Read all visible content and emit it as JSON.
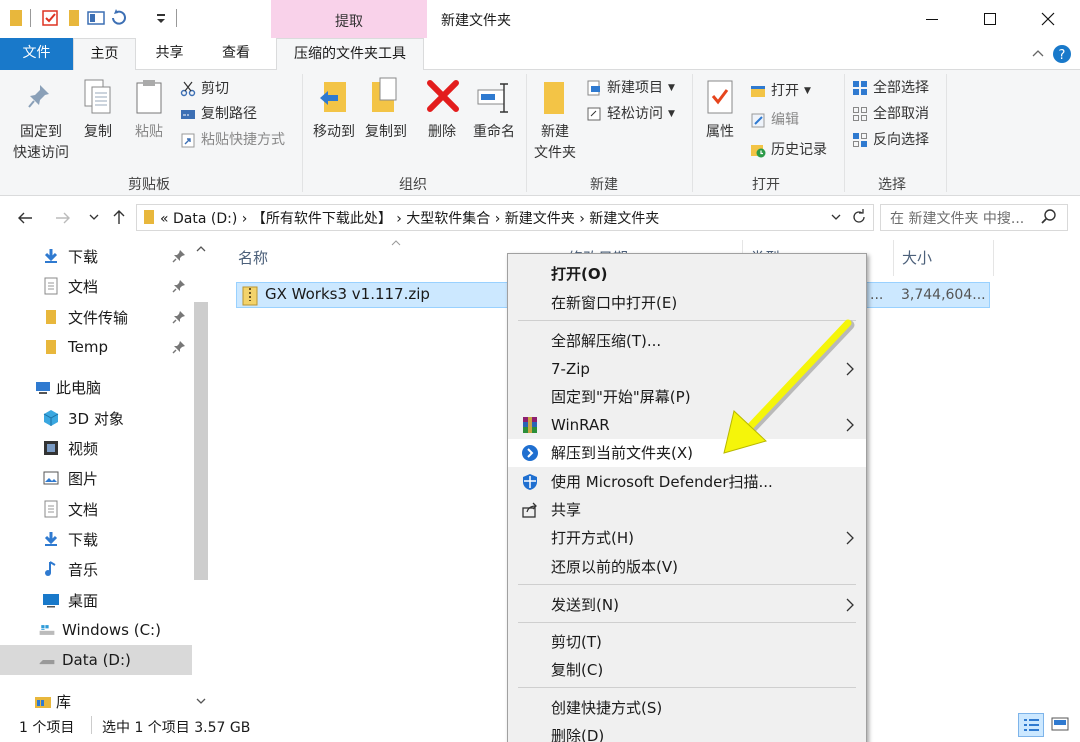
{
  "window": {
    "title": "新建文件夹",
    "tools_context_label": "提取"
  },
  "ribbon_tabs": {
    "file": "文件",
    "home": "主页",
    "share": "共享",
    "view": "查看",
    "zip_tools": "压缩的文件夹工具"
  },
  "ribbon": {
    "clipboard": {
      "pin_quick": "固定到\n快速访问",
      "copy": "复制",
      "paste": "粘贴",
      "cut": "剪切",
      "copy_path": "复制路径",
      "paste_shortcut": "粘贴快捷方式",
      "group": "剪贴板"
    },
    "organize": {
      "move_to": "移动到",
      "copy_to": "复制到",
      "delete": "删除",
      "rename": "重命名",
      "group": "组织"
    },
    "new": {
      "new_folder": "新建\n文件夹",
      "new_item": "新建项目",
      "easy_access": "轻松访问",
      "group": "新建"
    },
    "open": {
      "properties": "属性",
      "open": "打开",
      "edit": "编辑",
      "history": "历史记录",
      "group": "打开"
    },
    "select": {
      "select_all": "全部选择",
      "select_none": "全部取消",
      "invert": "反向选择",
      "group": "选择"
    }
  },
  "address": {
    "path": "«  Data (D:)  ›  【所有软件下载此处】  ›  大型软件集合  ›  新建文件夹  ›  新建文件夹",
    "search_placeholder": "在 新建文件夹 中搜..."
  },
  "nav": {
    "quick": [
      {
        "label": "下载"
      },
      {
        "label": "文档"
      },
      {
        "label": "文件传输"
      },
      {
        "label": "Temp"
      }
    ],
    "this_pc": "此电脑",
    "pc_items": [
      {
        "label": "3D 对象"
      },
      {
        "label": "视频"
      },
      {
        "label": "图片"
      },
      {
        "label": "文档"
      },
      {
        "label": "下载"
      },
      {
        "label": "音乐"
      },
      {
        "label": "桌面"
      },
      {
        "label": "Windows (C:)"
      },
      {
        "label": "Data (D:)"
      }
    ],
    "library": "库"
  },
  "columns": {
    "name": "名称",
    "date": "修改日期",
    "type": "类型",
    "size": "大小"
  },
  "file": {
    "name": "GX Works3 v1.117.zip",
    "size_partial": "...",
    "size": "3,744,604..."
  },
  "status": {
    "count": "1 个项目",
    "selected": "选中 1 个项目  3.57 GB"
  },
  "menu": {
    "open": "打开(O)",
    "open_new": "在新窗口中打开(E)",
    "extract_all": "全部解压缩(T)...",
    "zip7": "7-Zip",
    "pin_start": "固定到\"开始\"屏幕(P)",
    "winrar": "WinRAR",
    "extract_here": "解压到当前文件夹(X)",
    "defender": "使用 Microsoft Defender扫描...",
    "share": "共享",
    "open_with": "打开方式(H)",
    "restore": "还原以前的版本(V)",
    "send_to": "发送到(N)",
    "cut": "剪切(T)",
    "copy": "复制(C)",
    "shortcut": "创建快捷方式(S)",
    "delete": "删除(D)"
  },
  "colors": {
    "accent": "#1979ca",
    "selection": "#cce8ff",
    "tools_tab": "#f9d2ea",
    "arrow": "#f5f50a"
  }
}
